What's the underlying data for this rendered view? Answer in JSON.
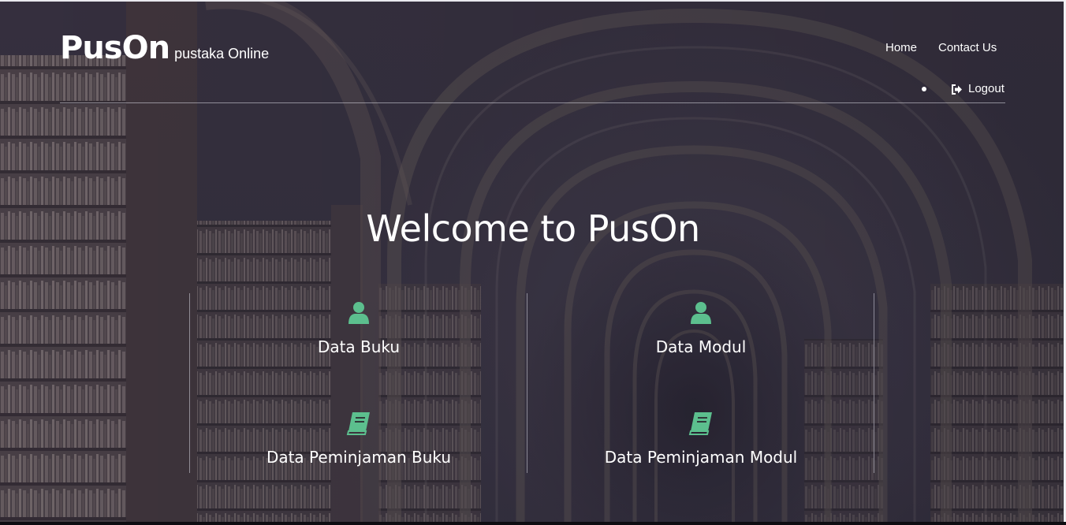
{
  "brand": {
    "title": "PusOn",
    "subtitle": "pustaka Online"
  },
  "nav": {
    "home": "Home",
    "contact": "Contact Us",
    "logout": "Logout"
  },
  "hero": {
    "title": "Welcome to PusOn"
  },
  "menu": {
    "items": [
      {
        "label": "Data Buku",
        "icon": "user-icon"
      },
      {
        "label": "Data Modul",
        "icon": "user-icon"
      },
      {
        "label": "Data Peminjaman Buku",
        "icon": "book-icon"
      },
      {
        "label": "Data Peminjaman Modul",
        "icon": "book-icon"
      }
    ]
  },
  "colors": {
    "icon_accent": "#5cbf8e",
    "text": "#ffffff",
    "overlay": "#24243a"
  }
}
